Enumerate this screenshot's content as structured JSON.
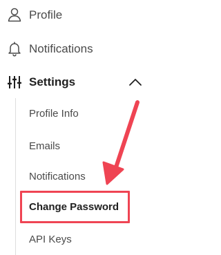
{
  "nav": {
    "profile": {
      "label": "Profile",
      "icon": "user-icon"
    },
    "notifications": {
      "label": "Notifications",
      "icon": "bell-icon"
    },
    "settings": {
      "label": "Settings",
      "icon": "sliders-icon",
      "expanded": true
    }
  },
  "settings_submenu": {
    "profile_info": "Profile Info",
    "emails": "Emails",
    "notifications": "Notifications",
    "change_password": "Change Password",
    "api_keys": "API Keys"
  },
  "annotation": {
    "highlight_color": "#ef4453",
    "highlighted_item": "Change Password"
  },
  "colors": {
    "text": "#4a4a4a",
    "text_strong": "#1f1f1f",
    "background": "#ffffff",
    "rail": "#dedede"
  }
}
